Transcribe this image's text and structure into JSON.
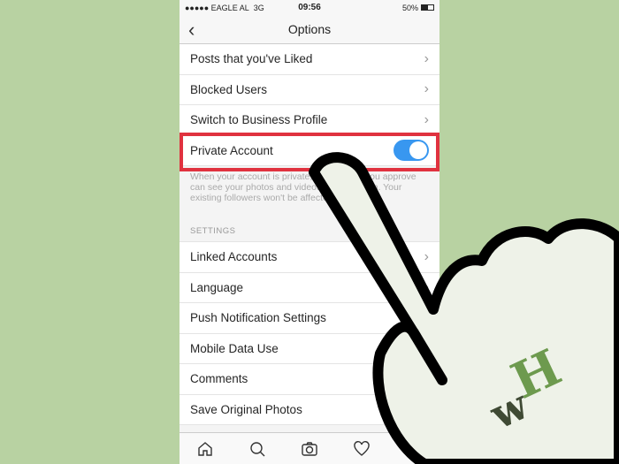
{
  "status": {
    "carrier": "●●●●● EAGLE AL",
    "network": "3G",
    "time": "09:56",
    "battery": "50%"
  },
  "nav": {
    "title": "Options",
    "back_icon": "chevron-left-icon"
  },
  "rows_top": [
    {
      "label": "Posts that you've Liked"
    },
    {
      "label": "Blocked Users"
    },
    {
      "label": "Switch to Business Profile"
    }
  ],
  "private_account": {
    "label": "Private Account",
    "enabled": true,
    "description": "When your account is private, only people you approve can see your photos and videos on Instagram. Your existing followers won't be affected."
  },
  "settings": {
    "header": "SETTINGS",
    "items": [
      {
        "label": "Linked Accounts"
      },
      {
        "label": "Language"
      },
      {
        "label": "Push Notification Settings"
      },
      {
        "label": "Mobile Data Use"
      },
      {
        "label": "Comments"
      }
    ],
    "save_original": {
      "label": "Save Original Photos",
      "enabled": true
    }
  },
  "tabbar": [
    "home-icon",
    "search-icon",
    "camera-icon",
    "heart-icon",
    "profile-icon"
  ],
  "colors": {
    "background": "#b8d2a2",
    "highlight": "#e0323f",
    "toggle": "#3897f0",
    "logo": "#6d9a4e"
  },
  "watermark": "wH"
}
